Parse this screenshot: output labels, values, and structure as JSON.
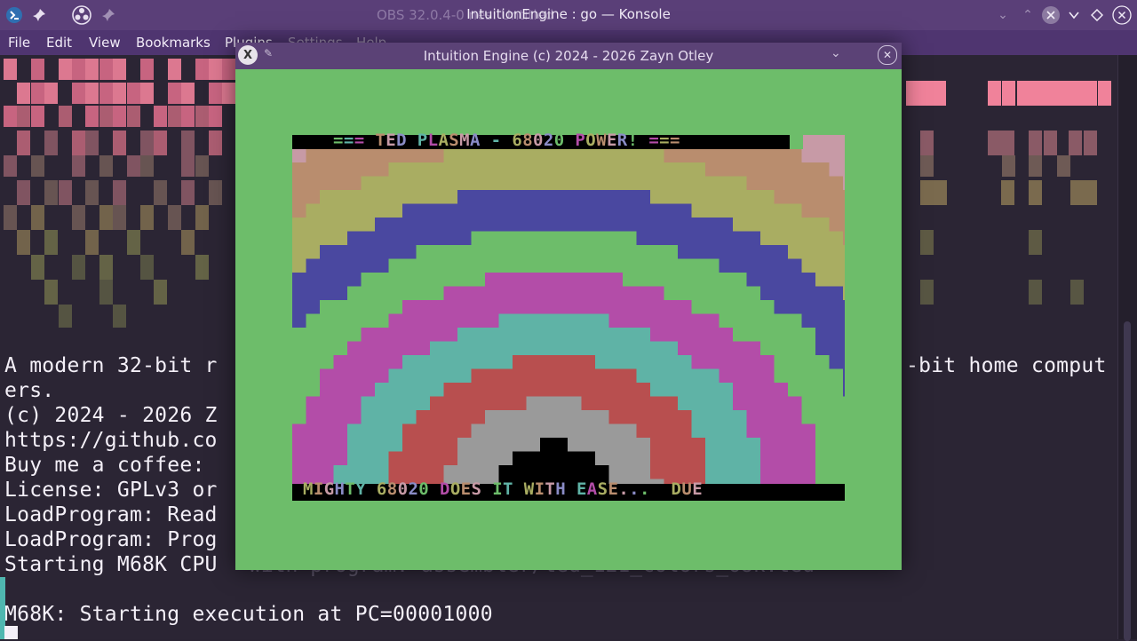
{
  "titlebar": {
    "title": "IntuitionEngine : go — Konsole",
    "background_ghost": "OBS 32.0.4-0                                          nes: Untitled",
    "icons": [
      "terminal-icon",
      "pin-icon",
      "obs-icon",
      "pin-icon"
    ],
    "window_buttons": [
      "minimize-icon",
      "maximize-icon",
      "close-icon",
      "chevron-down-icon",
      "keep-above-icon",
      "close-icon"
    ]
  },
  "menubar": {
    "items": [
      "File",
      "Edit",
      "View",
      "Bookmarks",
      "Plugins",
      "Settings",
      "Help"
    ]
  },
  "terminal": {
    "lines": [
      "A modern 32-bit r",
      "ers.",
      "(c) 2024 - 2026 Z",
      "https://github.co",
      "Buy me a coffee: ",
      "License: GPLv3 or",
      "LoadProgram: Read",
      "LoadProgram: Prog",
      "Starting M68K CPU",
      "",
      "M68K: Starting execution at PC=00001000"
    ],
    "right_fragment": "-bit home comput",
    "ghost_fragment": "with program: assembler/ted_121_colors_68k.ted",
    "colors": {
      "fg": "#f4f0f8",
      "bg": "#2b2534"
    }
  },
  "emulator": {
    "title": "Intuition Engine (c) 2024 - 2026 Zayn Otley",
    "border_color": "#6dbd6a",
    "screen": {
      "header_text": "=== TED PLASMA - 68020 POWER! ===",
      "scroller_text": "MIGHTY 68020 DOES IT WITH EASE...  DUE",
      "band_colors": [
        "#000000",
        "#9a9a9a",
        "#b84f4f",
        "#5fb3a6",
        "#b34da8",
        "#6dbd6a",
        "#4a48a0",
        "#a9ad62",
        "#b98d6e",
        "#c79aa6",
        "#8a8cc6"
      ]
    }
  }
}
